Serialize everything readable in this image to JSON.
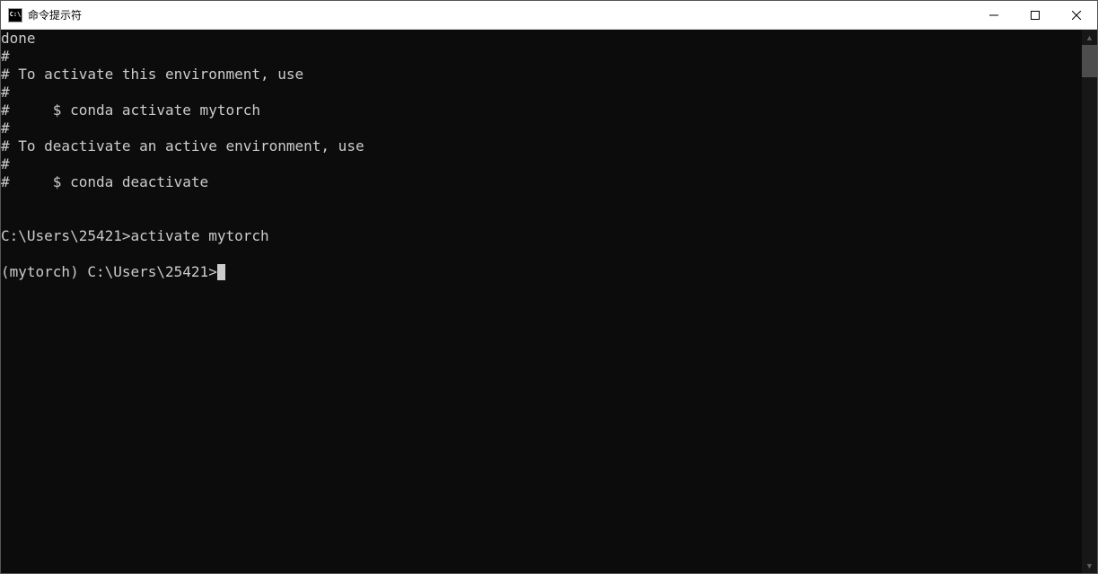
{
  "window": {
    "title": "命令提示符",
    "icon_text": "C:\\"
  },
  "terminal": {
    "lines": [
      "done",
      "#",
      "# To activate this environment, use",
      "#",
      "#     $ conda activate mytorch",
      "#",
      "# To deactivate an active environment, use",
      "#",
      "#     $ conda deactivate",
      "",
      "",
      "C:\\Users\\25421>activate mytorch",
      "",
      "(mytorch) C:\\Users\\25421>"
    ]
  }
}
